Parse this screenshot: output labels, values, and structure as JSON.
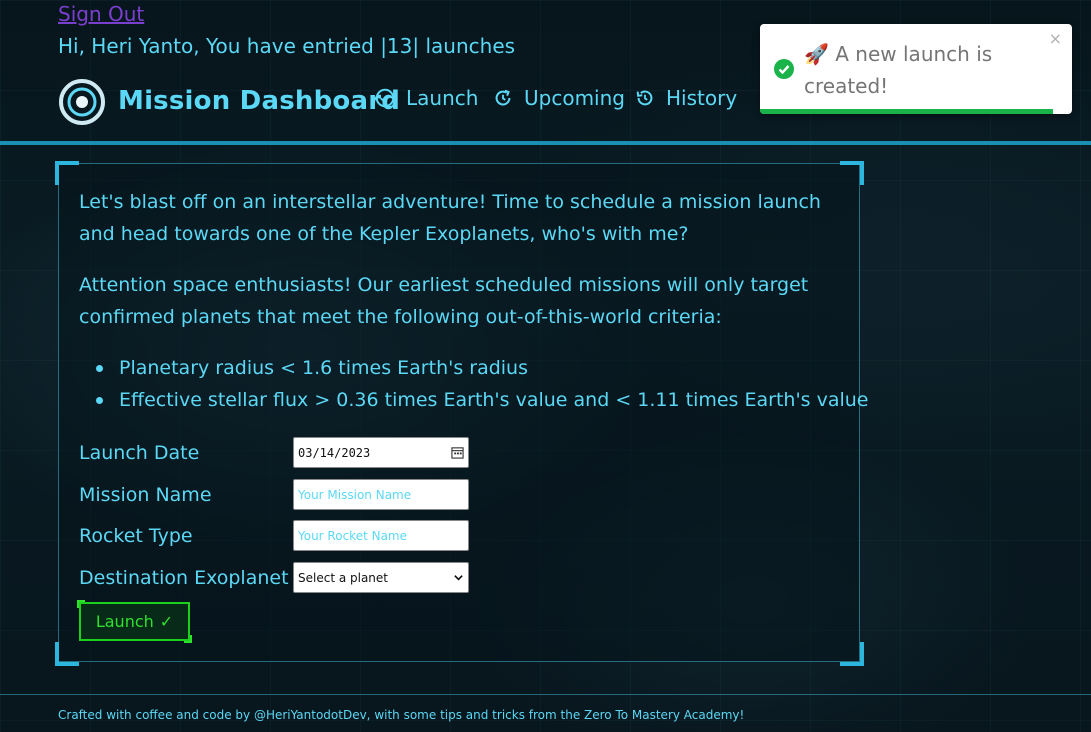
{
  "header": {
    "sign_out": "Sign Out",
    "greeting": "Hi, Heri Yanto, You have entried |13| launches",
    "title": "Mission Dashboard",
    "nav": [
      {
        "label": "Launch",
        "icon": "check-circle-icon"
      },
      {
        "label": "Upcoming",
        "icon": "refresh-clock-icon"
      },
      {
        "label": "History",
        "icon": "history-icon"
      }
    ]
  },
  "toast": {
    "emoji": "🚀",
    "message": "A new launch is created!",
    "close": "×",
    "status": "success",
    "progress": 0.94
  },
  "main": {
    "intro": "Let's blast off on an interstellar adventure! Time to schedule a mission launch and head towards one of the Kepler Exoplanets, who's with me?",
    "criteria_intro": "Attention space enthusiasts! Our earliest scheduled missions will only target confirmed planets that meet the following out-of-this-world criteria:",
    "criteria": [
      "Planetary radius < 1.6 times Earth's radius",
      "Effective stellar flux > 0.36 times Earth's value and < 1.11 times Earth's value"
    ]
  },
  "form": {
    "launch_date_label": "Launch Date",
    "launch_date_value": "03/14/2023",
    "mission_name_label": "Mission Name",
    "mission_name_placeholder": "Your Mission Name",
    "rocket_type_label": "Rocket Type",
    "rocket_type_placeholder": "Your Rocket Name",
    "destination_label": "Destination Exoplanet",
    "destination_selected": "Select a planet",
    "submit_label": "Launch",
    "submit_mark": "✓"
  },
  "footer": {
    "text": "Crafted with coffee and code by @HeriYantodotDev, with some tips and tricks from the Zero To Mastery Academy!"
  },
  "colors": {
    "accent": "#5bd8f5",
    "success": "#19b34a",
    "launch_green": "#2fe02f",
    "sign_out": "#7b3fd0"
  }
}
